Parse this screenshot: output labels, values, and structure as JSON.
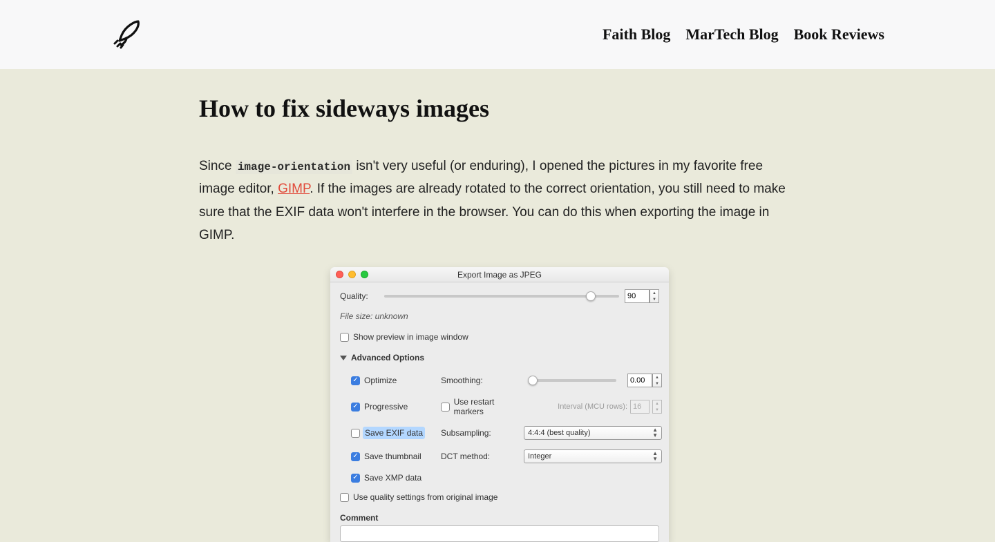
{
  "nav": {
    "items": [
      {
        "label": "Faith Blog"
      },
      {
        "label": "MarTech Blog"
      },
      {
        "label": "Book Reviews"
      }
    ]
  },
  "article": {
    "heading": "How to fix sideways images",
    "p_before_code": "Since ",
    "code": "image-orientation",
    "p_after_code_a": " isn't very useful (or enduring), I opened the pictures in my favorite free image editor, ",
    "link_label": "GIMP",
    "p_after_link": ". If the images are already rotated to the correct orientation, you still need to make sure that the EXIF data won't interfere in the browser. You can do this when exporting the image in GIMP."
  },
  "dialog": {
    "title": "Export Image as JPEG",
    "quality_label": "Quality:",
    "quality_value": "90",
    "filesize": "File size: unknown",
    "preview_label": "Show preview in image window",
    "adv_label": "Advanced Options",
    "optimize": "Optimize",
    "progressive": "Progressive",
    "save_exif": "Save EXIF data",
    "save_thumb": "Save thumbnail",
    "save_xmp": "Save XMP data",
    "use_quality": "Use quality settings from original image",
    "smoothing_label": "Smoothing:",
    "smoothing_value": "0.00",
    "restart_label": "Use restart markers",
    "interval_label": "Interval (MCU rows):",
    "interval_value": "16",
    "subsampling_label": "Subsampling:",
    "subsampling_value": "4:4:4 (best quality)",
    "dct_label": "DCT method:",
    "dct_value": "Integer",
    "comment_label": "Comment"
  }
}
